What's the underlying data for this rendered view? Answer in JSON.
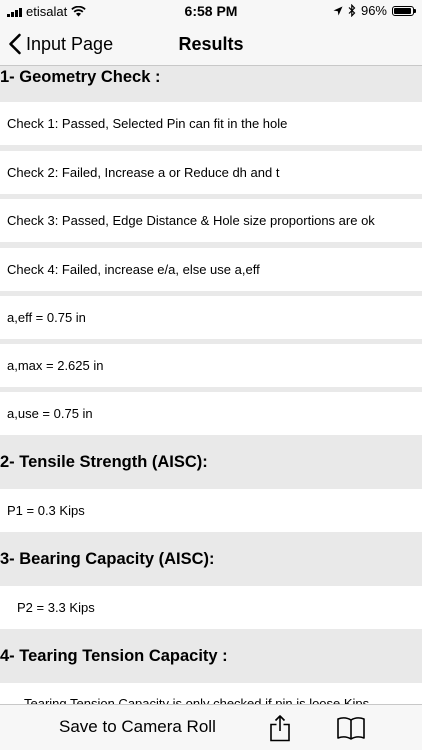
{
  "status": {
    "carrier": "etisalat",
    "time": "6:58 PM",
    "battery": "96%",
    "battery_level": 0.96
  },
  "nav": {
    "back_label": "Input Page",
    "title": "Results"
  },
  "sections": {
    "geometry": "1- Geometry Check :",
    "tensile": "2- Tensile Strength (AISC):",
    "bearing": "3- Bearing Capacity (AISC):",
    "tearing": "4- Tearing Tension Capacity :"
  },
  "items": {
    "check1": "Check 1:   Passed, Selected Pin can fit in the hole",
    "check2": "Check 2:   Failed, Increase a or Reduce dh and t",
    "check3": "Check 3:   Passed, Edge Distance & Hole size proportions are ok",
    "check4": "Check 4:   Failed, increase e/a, else use a,eff",
    "a_eff": "a,eff =   0.75 in",
    "a_max": "a,max =   2.625 in",
    "a_use": "a,use =   0.75 in",
    "p1": "P1 =   0.3 Kips",
    "p2": "P2 = 3.3 Kips",
    "tearing_note": "Tearing Tension Capacity is only checked if pin is loose Kips"
  },
  "toolbar": {
    "save_label": "Save to Camera Roll"
  },
  "icons": {
    "back": "chevron-left-icon",
    "share": "share-icon",
    "bookmarks": "book-icon"
  }
}
